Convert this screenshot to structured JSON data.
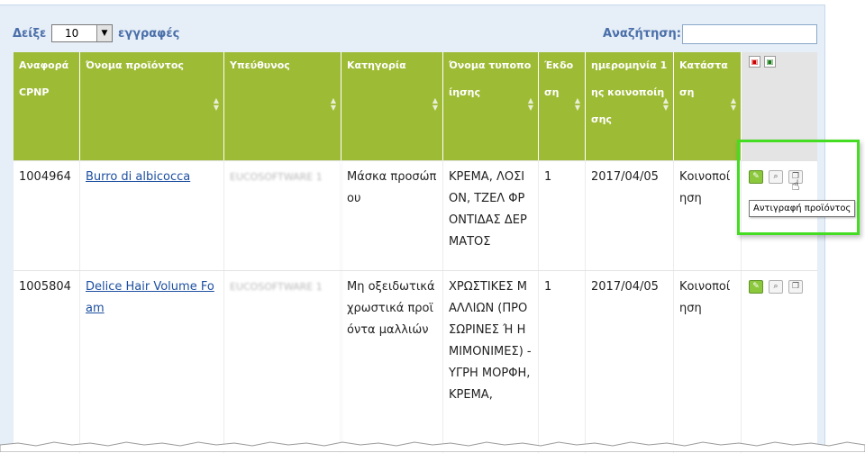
{
  "controls": {
    "show_label": "Δείξε",
    "page_size": "10",
    "records_label": "εγγραφές",
    "search_label": "Αναζήτηση:",
    "search_value": ""
  },
  "table": {
    "headers": [
      "Αναφορά CPNP",
      "Όνομα προϊόντος",
      "Υπεύθυνος",
      "Κατηγορία",
      "Όνομα τυποποίησης",
      "Έκδοση",
      "ημερομηνία 1ης κοινοποίησης",
      "Κατάσταση"
    ],
    "rows": [
      {
        "ref": "1004964",
        "name": "Burro di albicocca",
        "responsible": "EUCOSOFTWARE 1",
        "category": "Μάσκα προσώπου",
        "formulation": "ΚΡΕΜΑ, ΛΟΣΙΟΝ, ΤΖΕΛ ΦΡΟΝΤΙΔΑΣ ΔΕΡΜΑΤΟΣ",
        "version": "1",
        "date": "2017/04/05",
        "status": "Κοινοποίηση"
      },
      {
        "ref": "1005804",
        "name": "Delice Hair Volume Foam",
        "responsible": "EUCOSOFTWARE 1",
        "category": "Μη οξειδωτικά χρωστικά προϊόντα μαλλιών",
        "formulation": "ΧΡΩΣΤΙΚΕΣ ΜΑΛΛΙΩΝ (ΠΡΟΣΩΡΙΝΕΣ Ή ΗΜΙΜΟΝΙΜΕΣ) - ΥΓΡΗ ΜΟΡΦΗ, ΚΡΕΜΑ,",
        "version": "1",
        "date": "2017/04/05",
        "status": "Κοινοποίηση"
      }
    ]
  },
  "tooltip": "Αντιγραφή προϊόντος",
  "colors": {
    "header_green": "#9ebb35",
    "highlight_green": "#44dd22",
    "label_blue": "#4a6fa8"
  }
}
